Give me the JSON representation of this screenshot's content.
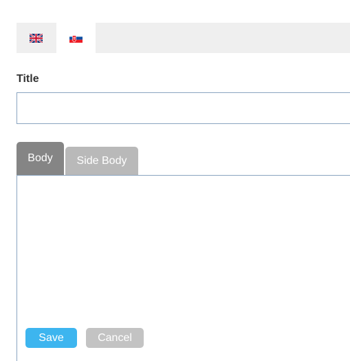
{
  "languages": [
    {
      "code": "en",
      "icon": "uk-flag-icon",
      "selected": false
    },
    {
      "code": "sk",
      "icon": "slovak-flag-icon",
      "selected": true
    }
  ],
  "form": {
    "title_label": "Title",
    "title_value": "",
    "title_placeholder": ""
  },
  "editor": {
    "tabs": [
      {
        "label": "Body",
        "active": true
      },
      {
        "label": "Side Body",
        "active": false
      }
    ],
    "content": ""
  },
  "actions": {
    "save_label": "Save",
    "cancel_label": "Cancel"
  },
  "colors": {
    "save": "#3db5ef",
    "cancel": "#c3c3c3",
    "active_tab": "#858585",
    "inactive_tab": "#b9b9b9",
    "border": "#8aa4c0"
  }
}
